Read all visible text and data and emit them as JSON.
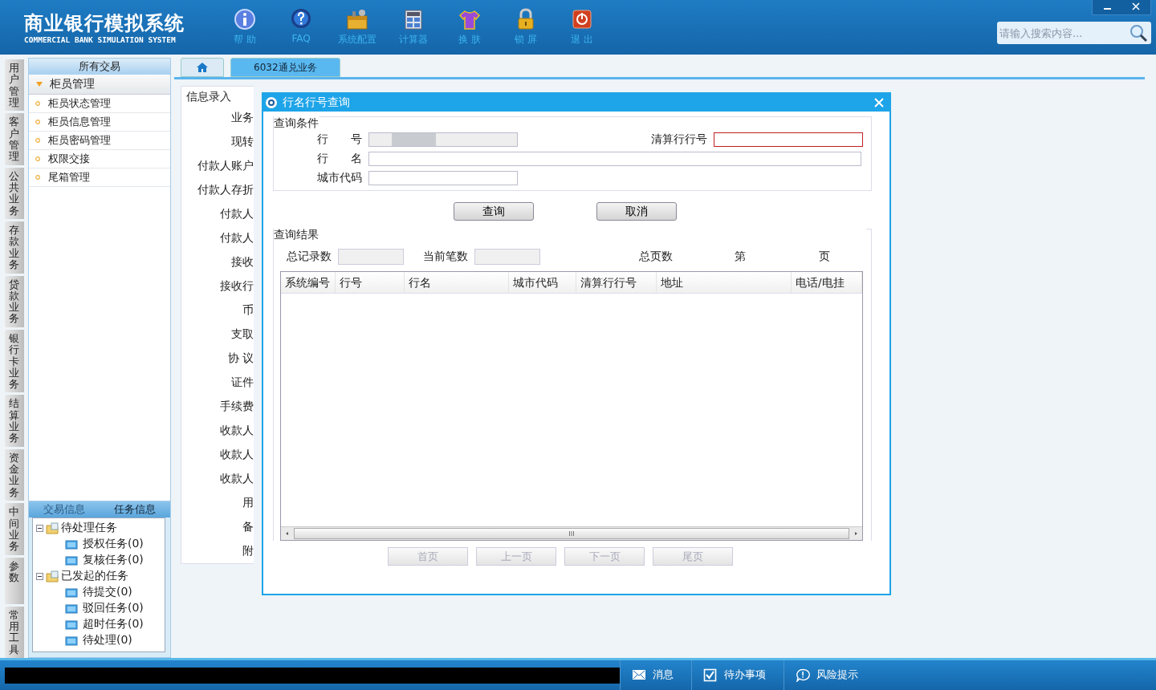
{
  "header": {
    "title": "商业银行模拟系统",
    "subtitle": "COMMERCIAL BANK SIMULATION SYSTEM",
    "tools": [
      {
        "kind": "info",
        "label": "帮 助"
      },
      {
        "kind": "faq",
        "label": "FAQ"
      },
      {
        "kind": "config",
        "label": "系统配置"
      },
      {
        "kind": "calc",
        "label": "计算器"
      },
      {
        "kind": "skin",
        "label": "换 肤"
      },
      {
        "kind": "lock",
        "label": "锁 屏"
      },
      {
        "kind": "exit",
        "label": "退 出"
      }
    ],
    "search": {
      "placeholder": "请输入搜索内容..."
    }
  },
  "side_tabs": [
    "用户管理",
    "客户管理",
    "公共业务",
    "存款业务",
    "贷款业务",
    "银行卡业务",
    "结算业务",
    "资金业务",
    "中间业务",
    "参数",
    "常用工具"
  ],
  "sidebar": {
    "title": "所有交易",
    "group": {
      "label": "柜员管理",
      "expanded": true
    },
    "items": [
      "柜员状态管理",
      "柜员信息管理",
      "柜员密码管理",
      "权限交接",
      "尾箱管理"
    ],
    "info_tabs": [
      {
        "label": "交易信息",
        "selected": false
      },
      {
        "label": "任务信息",
        "selected": true
      }
    ],
    "tree": [
      {
        "label": "待处理任务",
        "expanded": true,
        "children": [
          {
            "label": "授权任务(0)"
          },
          {
            "label": "复核任务(0)"
          }
        ]
      },
      {
        "label": "已发起的任务",
        "expanded": true,
        "children": [
          {
            "label": "待提交(0)"
          },
          {
            "label": "驳回任务(0)"
          },
          {
            "label": "超时任务(0)"
          },
          {
            "label": "待处理(0)"
          }
        ]
      }
    ]
  },
  "tabs": [
    {
      "kind": "home",
      "selected": false
    },
    {
      "kind": "text",
      "label": "6032通兑业务",
      "selected": true
    }
  ],
  "form": {
    "title": "信息录入",
    "labels": [
      "业务",
      "现转",
      "付款人账户",
      "付款人存折",
      "付款人",
      "付款人",
      "接收",
      "接收行",
      "币",
      "支取",
      "协 议",
      "证件",
      "手续费",
      "收款人",
      "收款人",
      "收款人",
      "用",
      "备",
      "附"
    ]
  },
  "dialog": {
    "title": "行名行号查询",
    "criteria": {
      "title": "查询条件",
      "fields": [
        {
          "label": "行　　号",
          "kind": "blurred"
        },
        {
          "label": "清算行行号",
          "kind": "focused"
        },
        {
          "label": "行　　名",
          "kind": "plain"
        },
        {
          "label": "城市代码",
          "kind": "plain"
        }
      ]
    },
    "buttons": [
      "查询",
      "取消"
    ],
    "results": {
      "title": "查询结果",
      "counts": [
        {
          "label": "总记录数"
        },
        {
          "label": "当前笔数"
        }
      ],
      "pages": [
        "总页数",
        "第",
        "页"
      ],
      "columns": [
        "系统编号",
        "行号",
        "行名",
        "城市代码",
        "清算行行号",
        "地址",
        "电话/电挂"
      ]
    },
    "pager": [
      {
        "label": "首页",
        "disabled": true
      },
      {
        "label": "上一页",
        "disabled": true
      },
      {
        "label": "下一页",
        "disabled": true
      },
      {
        "label": "尾页",
        "disabled": true
      }
    ]
  },
  "status_bar": [
    {
      "kind": "mail",
      "label": "消息"
    },
    {
      "kind": "check",
      "label": "待办事项"
    },
    {
      "kind": "bubble",
      "label": "风险提示"
    }
  ]
}
